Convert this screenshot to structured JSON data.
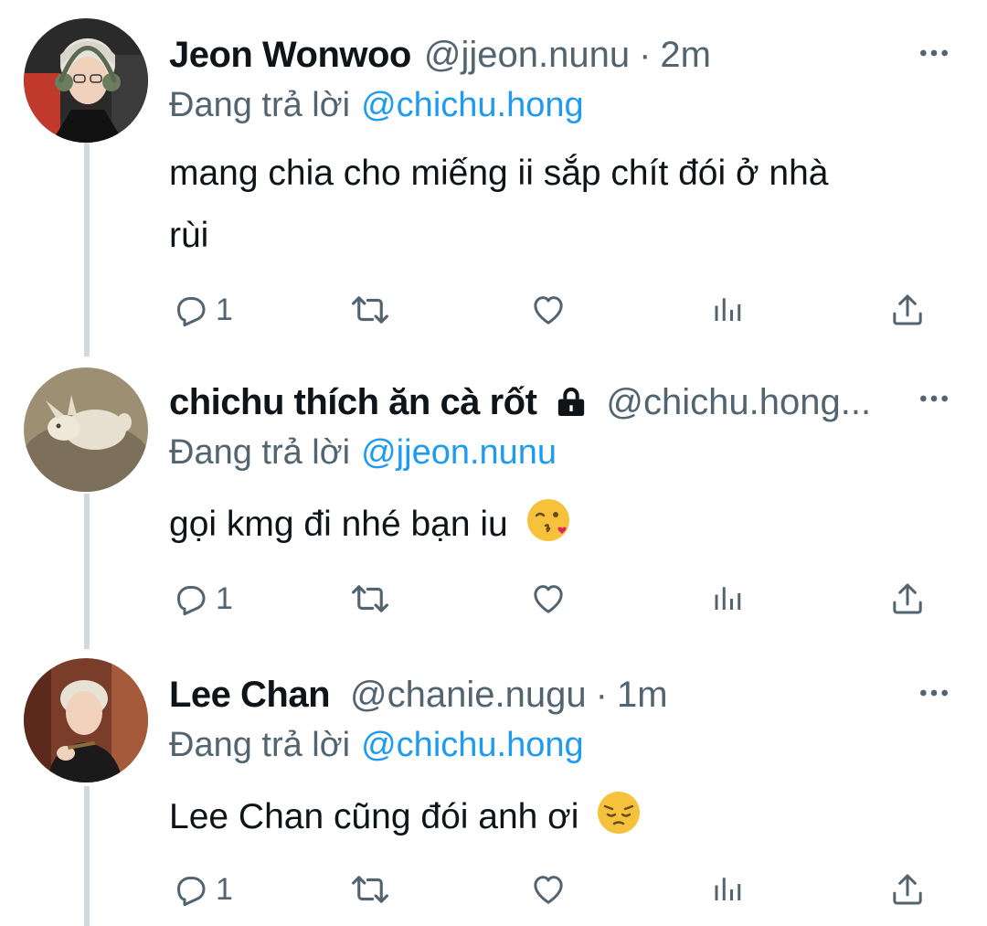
{
  "tweets": [
    {
      "display_name": "Jeon Wonwoo",
      "handle": "@jjeon.nunu",
      "separator": "·",
      "time": "2m",
      "reply_prefix": "Đang trả lời",
      "reply_to": "@chichu.hong",
      "text_line1": "mang chia cho miếng ii sắp chít đói ở nhà",
      "text_line2": "rùi",
      "reply_count": "1"
    },
    {
      "display_name": "chichu thích ăn cà rốt",
      "handle": "@chichu.hong...",
      "locked": true,
      "reply_prefix": "Đang trả lời",
      "reply_to": "@jjeon.nunu",
      "text": "gọi kmg đi nhé bạn iu",
      "emoji": "face-blowing-kiss",
      "reply_count": "1"
    },
    {
      "display_name": "Lee Chan",
      "handle": "@chanie.nugu",
      "separator": "·",
      "time": "1m",
      "reply_prefix": "Đang trả lời",
      "reply_to": "@chichu.hong",
      "text": "Lee Chan cũng đói anh ơi",
      "emoji": "pensive-face",
      "reply_count": "1"
    }
  ],
  "colors": {
    "text": "#0f1419",
    "muted": "#536471",
    "link": "#1d9bf0",
    "thread_line": "#cfd9de"
  }
}
